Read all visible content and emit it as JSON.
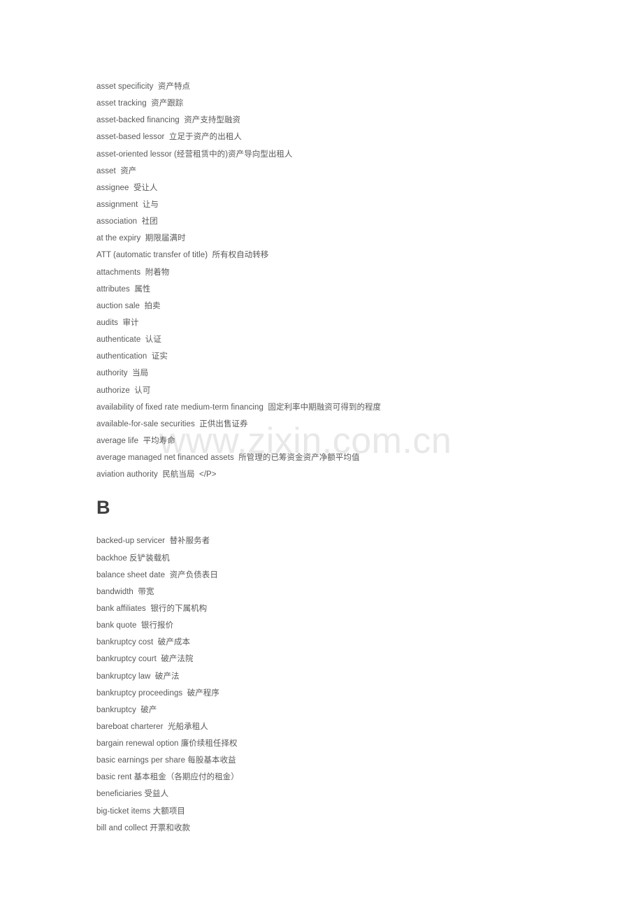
{
  "document": {
    "watermark": "www.zixin.com.cn",
    "colors": {
      "body_text": "#58595b",
      "heading_text": "#3f3f3f",
      "watermark": "#e8e8e8",
      "page_background": "#ffffff"
    }
  },
  "sections": [
    {
      "heading": null,
      "entries": [
        {
          "term": "asset specificity",
          "spacing": "wide",
          "definition": "资产特点"
        },
        {
          "term": "asset tracking",
          "spacing": "wide",
          "definition": "资产跟踪"
        },
        {
          "term": "asset-backed financing",
          "spacing": "wide",
          "definition": "资产支持型融资"
        },
        {
          "term": "asset-based lessor",
          "spacing": "wide",
          "definition": "立足于资产的出租人"
        },
        {
          "term": "asset-oriented lessor",
          "spacing": "narrow",
          "definition": "(经营租赁中的)资产导向型出租人"
        },
        {
          "term": "asset",
          "spacing": "wide",
          "definition": "资产"
        },
        {
          "term": "assignee",
          "spacing": "wide",
          "definition": "受让人"
        },
        {
          "term": "assignment",
          "spacing": "wide",
          "definition": "让与"
        },
        {
          "term": "association",
          "spacing": "wide",
          "definition": "社团"
        },
        {
          "term": "at the expiry",
          "spacing": "wide",
          "definition": "期限届满时"
        },
        {
          "term": "ATT (automatic transfer of title)",
          "spacing": "wide",
          "definition": "所有权自动转移"
        },
        {
          "term": "attachments",
          "spacing": "wide",
          "definition": "附着物"
        },
        {
          "term": "attributes",
          "spacing": "wide",
          "definition": "属性"
        },
        {
          "term": "auction sale",
          "spacing": "wide",
          "definition": "拍卖"
        },
        {
          "term": "audits",
          "spacing": "wide",
          "definition": "审计"
        },
        {
          "term": "authenticate",
          "spacing": "wide",
          "definition": "认证"
        },
        {
          "term": "authentication",
          "spacing": "wide",
          "definition": "证实"
        },
        {
          "term": "authority",
          "spacing": "wide",
          "definition": "当局"
        },
        {
          "term": "authorize",
          "spacing": "wide",
          "definition": "认可"
        },
        {
          "term": "availability of fixed rate medium-term financing",
          "spacing": "wide",
          "definition": "固定利率中期融资可得到的程度"
        },
        {
          "term": "available-for-sale securities",
          "spacing": "wide",
          "definition": "正供出售证券"
        },
        {
          "term": "average life",
          "spacing": "wide",
          "definition": "平均寿命"
        },
        {
          "term": "average managed net financed assets",
          "spacing": "wide",
          "definition": "所管理的已筹资金资产净额平均值"
        },
        {
          "term": "aviation authority",
          "spacing": "wide",
          "definition": "民航当局",
          "trailing": "</P>"
        }
      ]
    },
    {
      "heading": "B",
      "entries": [
        {
          "term": "backed-up servicer",
          "spacing": "wide",
          "definition": "替补服务者"
        },
        {
          "term": "backhoe",
          "spacing": "narrow",
          "definition": "反铲装载机"
        },
        {
          "term": "balance sheet date",
          "spacing": "wide",
          "definition": "资产负债表日"
        },
        {
          "term": "bandwidth",
          "spacing": "wide",
          "definition": "带宽"
        },
        {
          "term": "bank affiliates",
          "spacing": "wide",
          "definition": "银行的下属机构"
        },
        {
          "term": "bank quote",
          "spacing": "wide",
          "definition": "银行报价"
        },
        {
          "term": "bankruptcy cost",
          "spacing": "wide",
          "definition": "破产成本"
        },
        {
          "term": "bankruptcy court",
          "spacing": "wide",
          "definition": "破产法院"
        },
        {
          "term": "bankruptcy law",
          "spacing": "wide",
          "definition": "破产法"
        },
        {
          "term": "bankruptcy proceedings",
          "spacing": "wide",
          "definition": "破产程序"
        },
        {
          "term": "bankruptcy",
          "spacing": "wide",
          "definition": "破产"
        },
        {
          "term": "bareboat charterer",
          "spacing": "wide",
          "definition": "光船承租人"
        },
        {
          "term": "bargain renewal option",
          "spacing": "narrow",
          "definition": "廉价续租任择权"
        },
        {
          "term": "basic earnings per share",
          "spacing": "narrow",
          "definition": "每股基本收益"
        },
        {
          "term": "basic rent",
          "spacing": "narrow",
          "definition": "基本租金（各期应付的租金）"
        },
        {
          "term": "beneficiaries",
          "spacing": "narrow",
          "definition": "受益人"
        },
        {
          "term": "big-ticket items",
          "spacing": "narrow",
          "definition": "大额项目"
        },
        {
          "term": "bill and collect",
          "spacing": "narrow",
          "definition": "开票和收款"
        }
      ]
    }
  ]
}
